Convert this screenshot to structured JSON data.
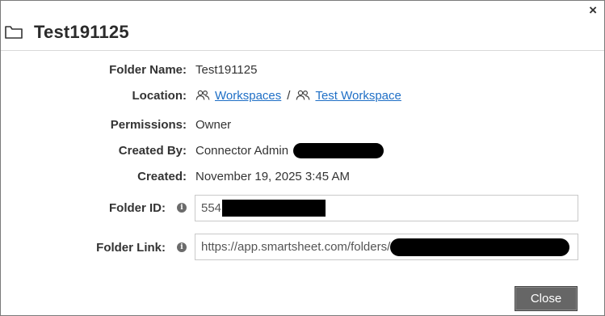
{
  "dialog": {
    "close_icon": "×",
    "title": "Test191125",
    "close_button": "Close"
  },
  "fields": {
    "folder_name": {
      "label": "Folder Name:",
      "value": "Test191125"
    },
    "location": {
      "label": "Location:",
      "path": [
        "Workspaces",
        "Test Workspace"
      ],
      "separator": "/"
    },
    "permissions": {
      "label": "Permissions:",
      "value": "Owner"
    },
    "created_by": {
      "label": "Created By:",
      "value": "Connector Admin"
    },
    "created": {
      "label": "Created:",
      "value": "November 19, 2025 3:45 AM"
    },
    "folder_id": {
      "label": "Folder ID:",
      "value": "554"
    },
    "folder_link": {
      "label": "Folder Link:",
      "value": "https://app.smartsheet.com/folders/"
    }
  },
  "icons": {
    "folder": "folder-icon",
    "workspace": "workspace-icon",
    "info": "info-icon",
    "close": "close-icon"
  },
  "colors": {
    "link": "#1f6fc6",
    "button_bg": "#666666",
    "redaction": "#000000"
  }
}
